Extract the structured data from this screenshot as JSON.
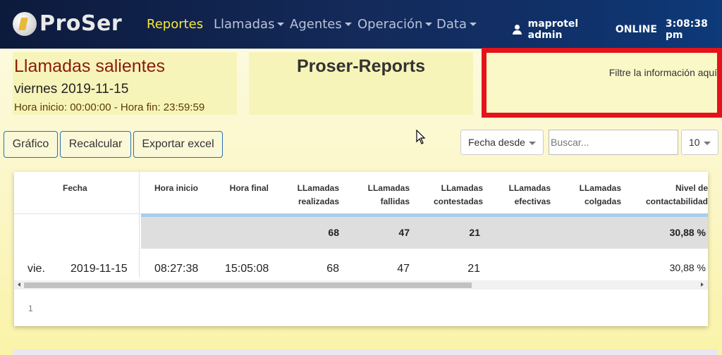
{
  "brand": {
    "name": "ProSer"
  },
  "nav": {
    "items": [
      {
        "label": "Reportes",
        "active": true,
        "dropdown": false
      },
      {
        "label": "Llamadas",
        "active": false,
        "dropdown": true
      },
      {
        "label": "Agentes",
        "active": false,
        "dropdown": true
      },
      {
        "label": "Operación",
        "active": false,
        "dropdown": true
      },
      {
        "label": "Data",
        "active": false,
        "dropdown": true
      }
    ],
    "user": "maprotel admin",
    "status": "ONLINE",
    "time": "3:08:38 pm"
  },
  "report": {
    "title": "Llamadas salientes",
    "date": "viernes 2019-11-15",
    "hours": "Hora inicio: 00:00:00 - Hora fin: 23:59:59",
    "app_title": "Proser-Reports",
    "filter_hint": "Filtre la información aquí"
  },
  "toolbar": {
    "chart_label": "Gráfico",
    "recalc_label": "Recalcular",
    "export_label": "Exportar excel",
    "date_filter": "Fecha desde",
    "search_placeholder": "Buscar...",
    "page_size": "10"
  },
  "table": {
    "headers": {
      "fecha": "Fecha",
      "hora_inicio": "Hora inicio",
      "hora_final": "Hora final",
      "realizadas_1": "LLamadas",
      "realizadas_2": "realizadas",
      "fallidas_1": "LLamadas",
      "fallidas_2": "fallidas",
      "contestadas_1": "LLamadas",
      "contestadas_2": "contestadas",
      "efectivas_1": "LLamadas",
      "efectivas_2": "efectivas",
      "colgadas_1": "LLamadas",
      "colgadas_2": "colgadas",
      "nivel_1": "Nivel de",
      "nivel_2": "contactabilidad"
    },
    "summary": {
      "realizadas": "68",
      "fallidas": "47",
      "contestadas": "21",
      "nivel": "30,88 %"
    },
    "row": {
      "dia": "vie.",
      "fecha": "2019-11-15",
      "hora_inicio": "08:27:38",
      "hora_final": "15:05:08",
      "realizadas": "68",
      "fallidas": "47",
      "contestadas": "21",
      "nivel": "30,88 %"
    },
    "page": "1"
  },
  "colors": {
    "nav_active": "#f6e93b",
    "highlight_border": "#e3131b",
    "title_red": "#8b1a10",
    "panel_bg": "#f7f4b9"
  }
}
